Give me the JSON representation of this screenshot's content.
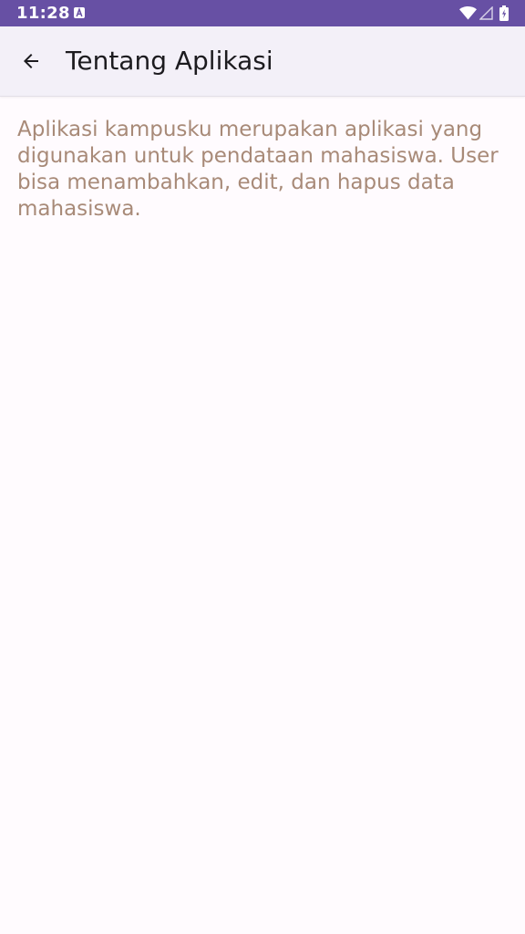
{
  "status_bar": {
    "time": "11:28",
    "background": "#6750a4",
    "icons": [
      "a-notification-icon",
      "wifi-icon",
      "cellular-signal-icon",
      "battery-charging-icon"
    ]
  },
  "app_bar": {
    "title": "Tentang Aplikasi",
    "back_icon": "arrow-back-icon"
  },
  "content": {
    "description": "Aplikasi kampusku merupakan aplikasi yang digunakan untuk pendataan mahasiswa. User bisa menambahkan, edit, dan hapus data mahasiswa.",
    "text_color": "#a88a78"
  },
  "colors": {
    "accent": "#6750a4",
    "page_background": "#fffbfe",
    "app_bar_background": "#f3f0f8"
  }
}
